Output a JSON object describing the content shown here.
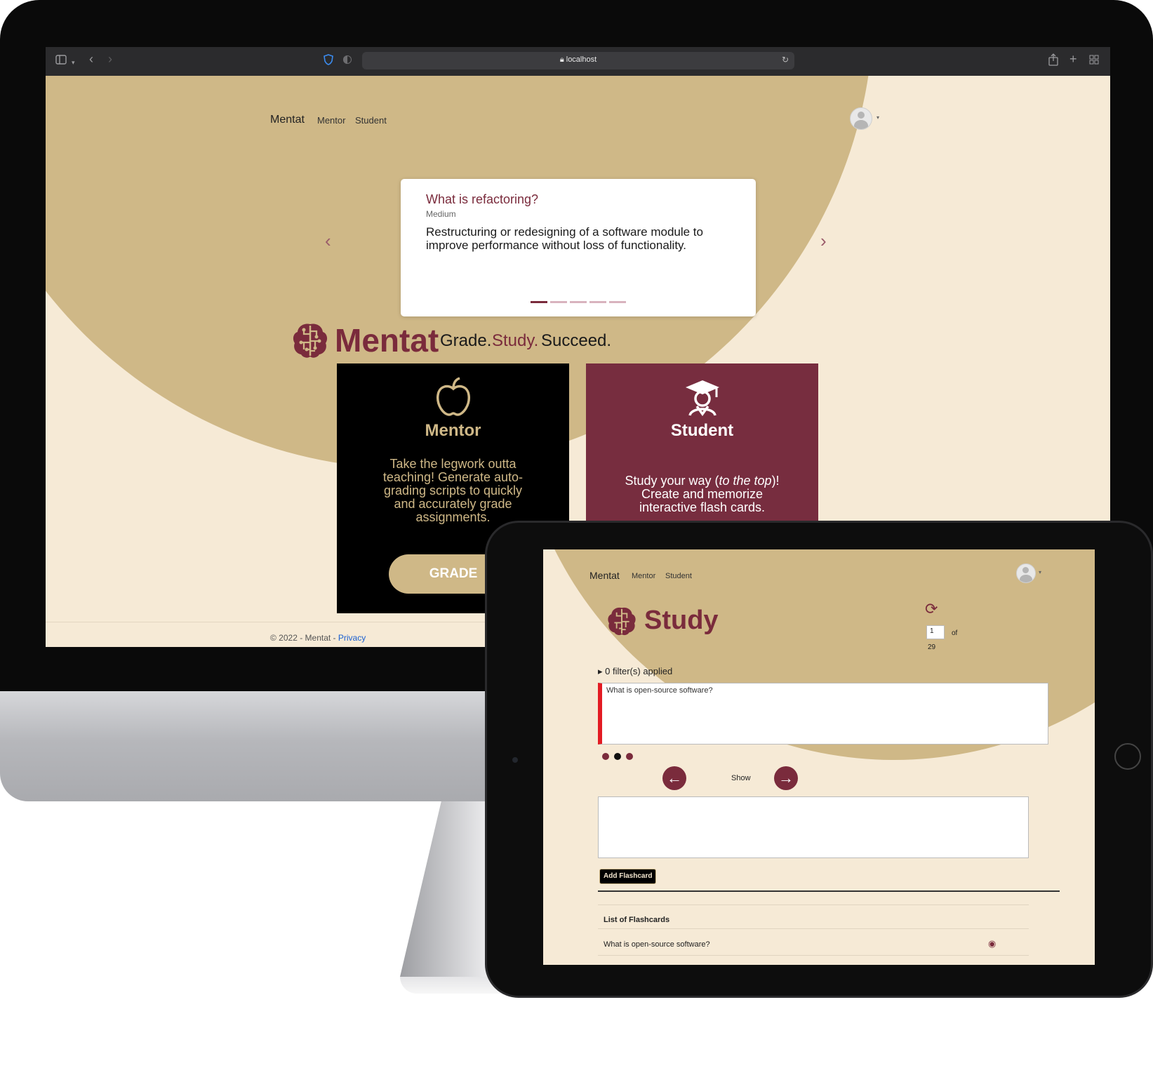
{
  "browser": {
    "url": "localhost"
  },
  "desktop": {
    "nav": {
      "brand": "Mentat",
      "links": [
        "Mentor",
        "Student"
      ]
    },
    "carousel": {
      "question": "What is refactoring?",
      "difficulty": "Medium",
      "answer": "Restructuring or redesigning of a software module to improve performance without loss of functionality.",
      "slide_count": 5,
      "active_slide": 1
    },
    "hero": {
      "brand": "Mentat",
      "tagline": [
        "Grade.",
        "Study.",
        "Succeed."
      ]
    },
    "mentor_card": {
      "title": "Mentor",
      "description": "Take the legwork outta teaching! Generate auto-grading scripts to quickly and accurately grade assignments.",
      "button": "GRADE"
    },
    "student_card": {
      "title": "Student",
      "description_pre": "Study your way (",
      "description_em": "to the top",
      "description_post": ")! Create and memorize interactive flash cards."
    },
    "footer": {
      "text": "© 2022 - Mentat - ",
      "link": "Privacy"
    }
  },
  "tablet": {
    "nav": {
      "brand": "Mentat",
      "links": [
        "Mentor",
        "Student"
      ]
    },
    "title": "Study",
    "pager": {
      "current": "1",
      "of_label": "of",
      "total": "29"
    },
    "filters": "0 filter(s) applied",
    "question_text": "What is open-source software?",
    "show_label": "Show",
    "add_button": "Add Flashcard",
    "list_header": "List of Flashcards",
    "list_items": [
      "What is open-source software?"
    ]
  },
  "colors": {
    "brand": "#7a2b3c",
    "sand": "#cfb887",
    "cream": "#f6ead6",
    "dark": "#000000"
  },
  "icons": [
    "sidebar-icon",
    "chevron-down-icon",
    "back-icon",
    "forward-icon",
    "shield-icon",
    "reader-icon",
    "lock-icon",
    "reload-icon",
    "share-icon",
    "new-tab-icon",
    "tab-overview-icon",
    "brain-logo-icon",
    "apple-icon",
    "graduate-icon",
    "refresh-icon",
    "eye-icon",
    "arrow-left-icon",
    "arrow-right-icon"
  ]
}
